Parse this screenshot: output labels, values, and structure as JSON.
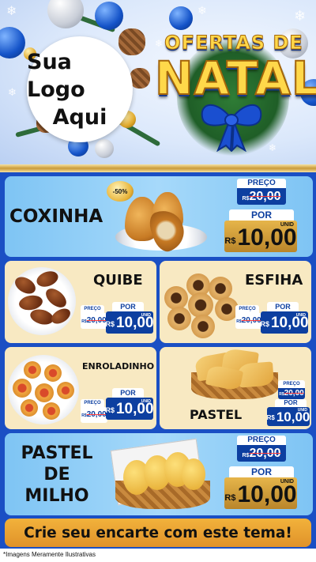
{
  "header": {
    "logo_line1": "Sua Logo",
    "logo_line2": "Aqui",
    "title_line1": "OFERTAS DE",
    "title_line2": "NATAL"
  },
  "labels": {
    "price": "PREÇO",
    "por": "POR",
    "unid": "UNID",
    "currency": "R$"
  },
  "products": [
    {
      "name_lines": [
        "COXINHA"
      ],
      "old_price": "20,00",
      "new_price": "10,00",
      "discount_badge": "-50%"
    },
    {
      "name_lines": [
        "QUIBE"
      ],
      "old_price": "20,00",
      "new_price": "10,00"
    },
    {
      "name_lines": [
        "ESFIHA"
      ],
      "old_price": "20,00",
      "new_price": "10,00"
    },
    {
      "name_lines": [
        "ENROLADINHO"
      ],
      "old_price": "20,00",
      "new_price": "10,00"
    },
    {
      "name_lines": [
        "PASTEL"
      ],
      "old_price": "20,00",
      "new_price": "10,00"
    },
    {
      "name_lines": [
        "PASTEL",
        "DE",
        "MILHO"
      ],
      "old_price": "20,00",
      "new_price": "10,00"
    }
  ],
  "banner": "Crie seu encarte com este tema!",
  "footnote": "*Imagens Meramente Ilustrativas",
  "colors": {
    "accent_blue": "#0d3fa0",
    "gold": "#e6b54a",
    "banner": "#f2b23b"
  },
  "icons": [
    "snowflake-icon",
    "ornament-ball-icon",
    "pinecone-icon",
    "ribbon-bow-icon"
  ]
}
